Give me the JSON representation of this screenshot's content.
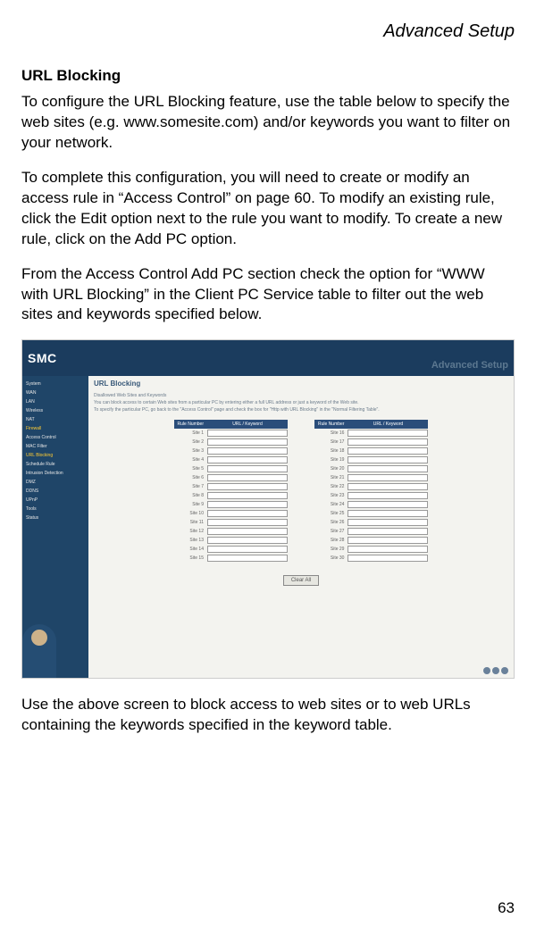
{
  "header": {
    "title": "Advanced Setup"
  },
  "section": {
    "title": "URL Blocking",
    "para1": "To configure the URL Blocking feature, use the table below to specify the web sites (e.g. www.somesite.com) and/or keywords you want to filter on your network.",
    "para2": "To complete this configuration, you will need to create or modify an access rule in “Access Control” on page 60. To modify an existing rule, click the Edit option next to the rule you want to modify. To create a new rule, click on the Add PC option.",
    "para3": "From the Access Control Add PC section check the option for “WWW with URL Blocking” in the Client PC Service table to filter out the web sites and keywords specified below.",
    "para4": "Use the above screen to block access to web sites or to web URLs containing the keywords specified in the keyword table."
  },
  "screenshot": {
    "logo": "SMC",
    "badge": "Advanced Setup",
    "sidebar": [
      "System",
      "WAN",
      "LAN",
      "Wireless",
      "NAT",
      "Firewall",
      "Access Control",
      "MAC Filter",
      "URL Blocking",
      "Schedule Rule",
      "Intrusion Detection",
      "DMZ",
      "DDNS",
      "UPnP",
      "Tools",
      "Status"
    ],
    "panel_title": "URL Blocking",
    "panel_sub1": "Disallowed Web Sites and Keywords",
    "panel_sub2": "You can block access to certain Web sites from a particular PC by entering either a full URL address or just a keyword of the Web site.",
    "panel_sub3": "To specify the particular PC, go back to the \"Access Control\" page and check the box for \"Http with URL Blocking\" in the \"Normal Filtering Table\".",
    "col_rule": "Rule Number",
    "col_url": "URL / Keyword",
    "rows_left": [
      "Site 1",
      "Site 2",
      "Site 3",
      "Site 4",
      "Site 5",
      "Site 6",
      "Site 7",
      "Site 8",
      "Site 9",
      "Site 10",
      "Site 11",
      "Site 12",
      "Site 13",
      "Site 14",
      "Site 15"
    ],
    "rows_right": [
      "Site 16",
      "Site 17",
      "Site 18",
      "Site 19",
      "Site 20",
      "Site 21",
      "Site 22",
      "Site 23",
      "Site 24",
      "Site 25",
      "Site 26",
      "Site 27",
      "Site 28",
      "Site 29",
      "Site 30"
    ],
    "button": "Clear All"
  },
  "page_number": "63"
}
